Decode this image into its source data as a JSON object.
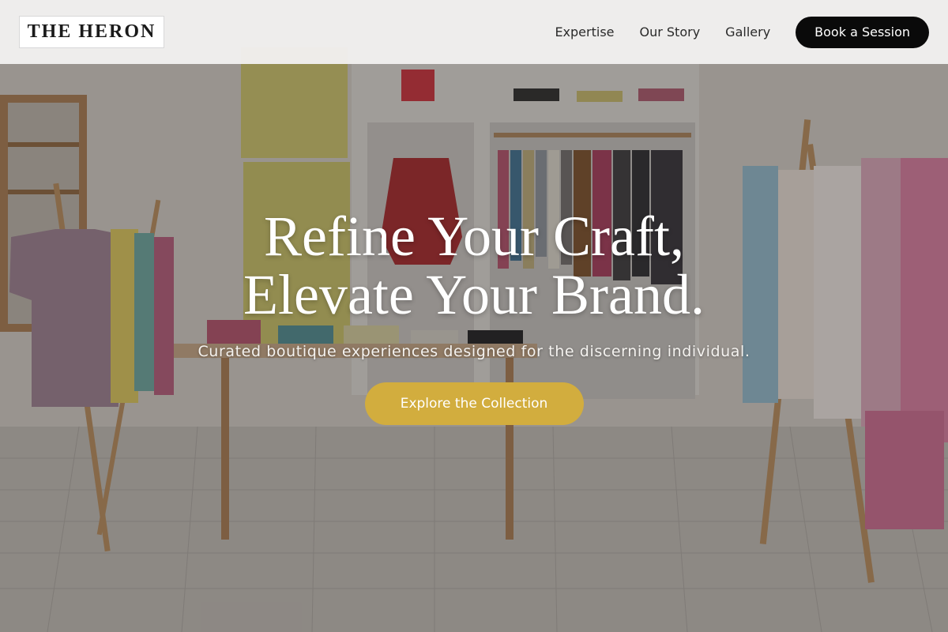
{
  "brand": {
    "logo_text": "THE HERON"
  },
  "nav": {
    "links": [
      {
        "label": "Expertise"
      },
      {
        "label": "Our Story"
      },
      {
        "label": "Gallery"
      }
    ],
    "cta_label": "Book a Session"
  },
  "hero": {
    "headline_line1": "Refine Your Craft,",
    "headline_line2": "Elevate Your Brand.",
    "subheadline": "Curated boutique experiences designed for the discerning individual.",
    "cta_label": "Explore the Collection",
    "background_image": "boutique-clothing-store-interior"
  },
  "colors": {
    "nav_cta_bg": "#0a0a0a",
    "hero_cta_bg": "#d2ad3e",
    "navbar_bg": "#f3f2f2"
  }
}
